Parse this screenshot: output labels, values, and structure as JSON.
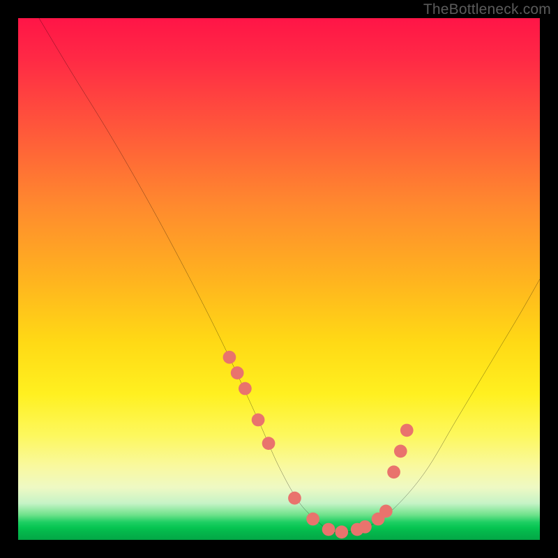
{
  "watermark": "TheBottleneck.com",
  "chart_data": {
    "type": "line",
    "title": "",
    "xlabel": "",
    "ylabel": "",
    "xlim": [
      0,
      100
    ],
    "ylim": [
      0,
      100
    ],
    "grid": false,
    "legend": false,
    "series": [
      {
        "name": "bottleneck-curve",
        "x": [
          4,
          10,
          18,
          26,
          34,
          40,
          46,
          50,
          54,
          58,
          60,
          63,
          67,
          72,
          78,
          84,
          90,
          96,
          100
        ],
        "y": [
          100,
          90,
          77,
          63,
          48,
          36,
          23,
          14,
          7,
          3,
          1.5,
          1.5,
          2.5,
          6,
          13,
          23,
          33,
          43,
          50
        ]
      }
    ],
    "markers": {
      "name": "highlight-dots",
      "color": "#e9736d",
      "x": [
        40.5,
        42.0,
        43.5,
        46.0,
        48.0,
        53.0,
        56.5,
        59.5,
        62.0,
        65.0,
        66.5,
        69.0,
        70.5,
        72.0,
        73.3,
        74.5
      ],
      "y": [
        35.0,
        32.0,
        29.0,
        23.0,
        18.5,
        8.0,
        4.0,
        2.0,
        1.5,
        2.0,
        2.5,
        4.0,
        5.5,
        13.0,
        17.0,
        21.0
      ]
    },
    "background_gradient": {
      "top": "#ff1547",
      "mid": "#ffd915",
      "bottom": "#03a746"
    }
  }
}
